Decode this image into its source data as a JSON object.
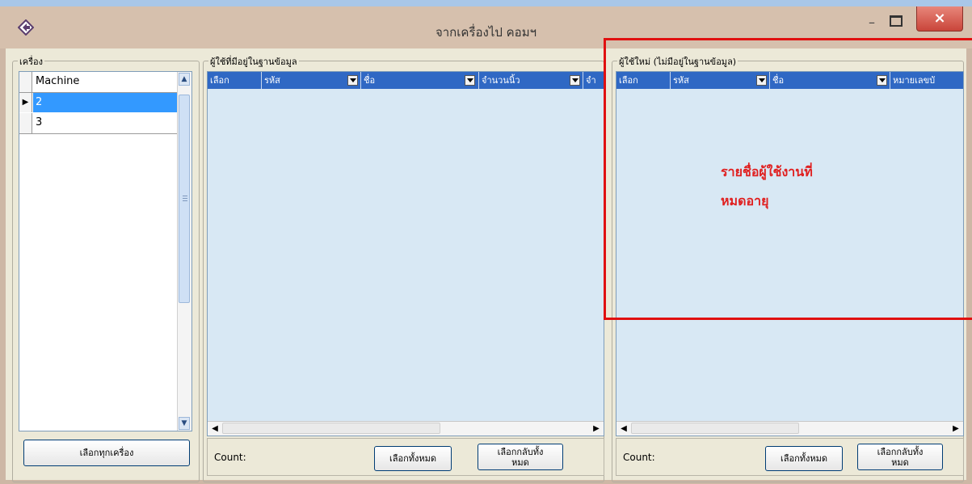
{
  "window": {
    "title": "จากเครื่องไป คอมฯ",
    "minimize_label": "–",
    "close_label": "×"
  },
  "machines_panel": {
    "label": "เครื่อง",
    "column_header": "Machine",
    "rows": [
      "2",
      "3"
    ],
    "selected_row": "2",
    "select_all_machines_button": "เลือกทุกเครื่อง"
  },
  "existing_users_panel": {
    "label": "ผู้ใช้ที่มีอยู่ในฐานข้อมูล",
    "columns": [
      "เลือก",
      "รหัส",
      "ชื่อ",
      "จำนวนนิ้ว",
      "จำ"
    ],
    "count_label": "Count:",
    "select_all_button": "เลือกทั้งหมด",
    "invert_selection_button": [
      "เลือกกลับทั้ง",
      "หมด"
    ]
  },
  "new_users_panel": {
    "label": "ผู้ใช้ใหม่ (ไม่มีอยู่ในฐานข้อมูล)",
    "columns": [
      "เลือก",
      "รหัส",
      "ชื่อ",
      "หมายเลขบั"
    ],
    "count_label": "Count:",
    "select_all_button": "เลือกทั้งหมด",
    "invert_selection_button": [
      "เลือกกลับทั้ง",
      "หมด"
    ]
  },
  "annotation": {
    "lines": [
      "รายชื่อผู้ใช้งานที่",
      "หมดอายุ"
    ],
    "color": "#e02020"
  },
  "colors": {
    "grid_header": "#2f68c4",
    "grid_body": "#d8e8f4",
    "selected_row": "#3399ff",
    "highlight_box": "#e01010"
  }
}
